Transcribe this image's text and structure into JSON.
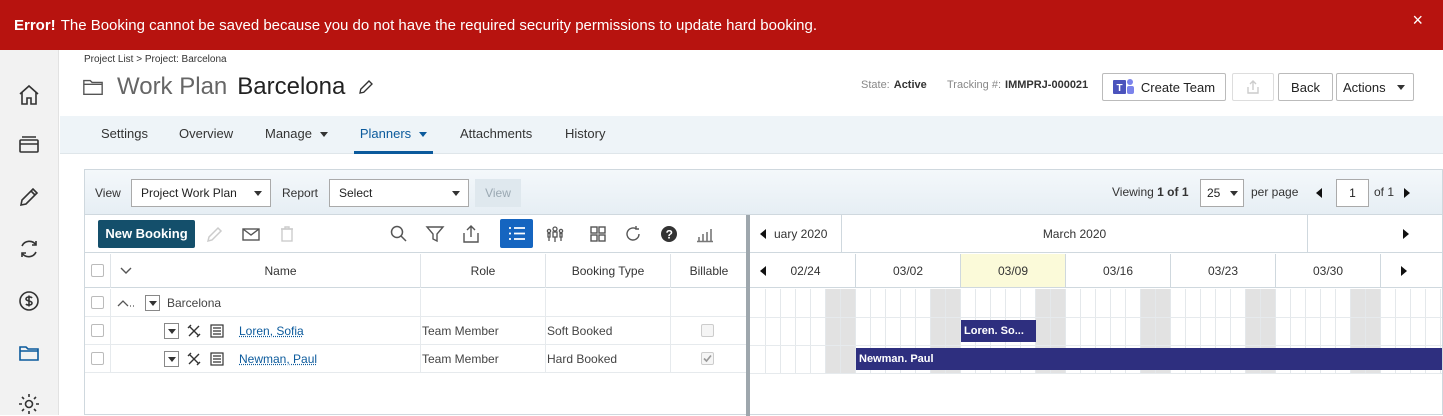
{
  "error": {
    "prefix": "Error!",
    "message": "The Booking cannot be saved because you do not have the required security permissions to update hard booking.",
    "close": "×"
  },
  "header": {
    "breadcrumb": "Project List > Project: Barcelona",
    "title": "Work Plan",
    "project": "Barcelona",
    "state_label": "State:",
    "state_value": "Active",
    "tracking_label": "Tracking #:",
    "tracking_value": "IMMPRJ-000021",
    "create_team": "Create Team",
    "back": "Back",
    "actions": "Actions"
  },
  "tabs": [
    {
      "label": "Settings"
    },
    {
      "label": "Overview"
    },
    {
      "label": "Manage"
    },
    {
      "label": "Planners"
    },
    {
      "label": "Attachments"
    },
    {
      "label": "History"
    }
  ],
  "filter": {
    "view_label": "View",
    "view_value": "Project Work Plan",
    "report_label": "Report",
    "report_value": "Select",
    "view_button": "View",
    "viewing_prefix": "Viewing",
    "viewing_range": "1 of 1",
    "per_page_value": "25",
    "per_page_label": "per page",
    "page_value": "1",
    "page_of": "of 1"
  },
  "toolbar": {
    "new_booking": "New Booking"
  },
  "grid": {
    "columns": {
      "name": "Name",
      "role": "Role",
      "booking_type": "Booking Type",
      "billable": "Billable"
    },
    "group": {
      "name": "Barcelona"
    },
    "rows": [
      {
        "name": "Loren, Sofia",
        "role": "Team Member",
        "booking_type": "Soft Booked",
        "billable": false
      },
      {
        "name": "Newman, Paul",
        "role": "Team Member",
        "booking_type": "Hard Booked",
        "billable": true
      }
    ]
  },
  "gantt": {
    "months": [
      "uary 2020",
      "March 2020"
    ],
    "weeks": [
      "02/24",
      "03/02",
      "03/09",
      "03/16",
      "03/23",
      "03/30"
    ],
    "current_week": "03/09",
    "bars": [
      {
        "label": "Loren. So..."
      },
      {
        "label": "Newman. Paul"
      }
    ],
    "bar_color": "#2e2f7f"
  },
  "colors": {
    "error": "#b7130f",
    "primary": "#144f6b",
    "accent": "#0b5a9c"
  }
}
